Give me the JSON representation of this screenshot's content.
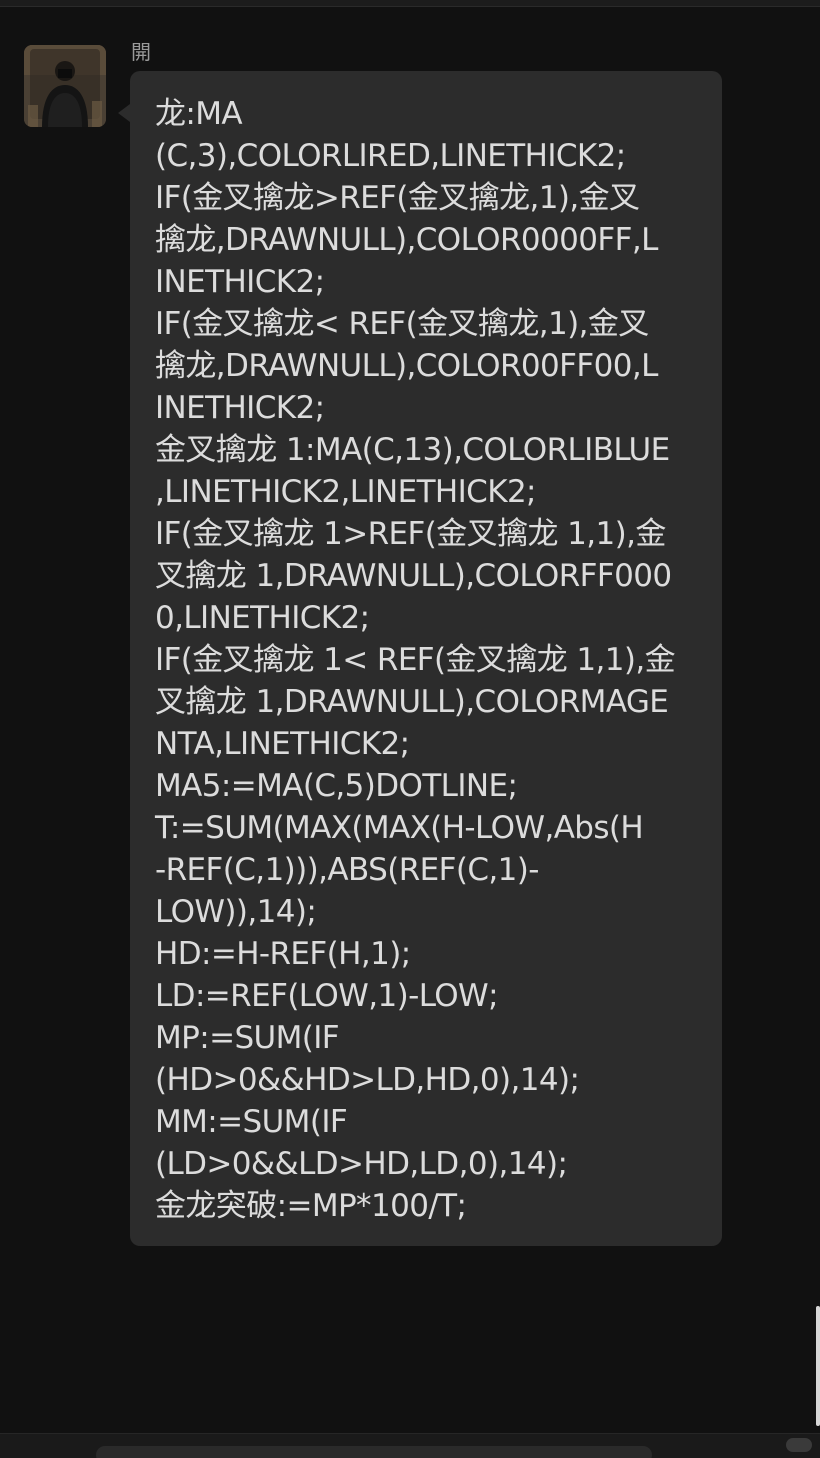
{
  "chat": {
    "sender_name": "開",
    "message_lines": [
      "龙:MA",
      "(C,3),COLORLIRED,LINETHICK2;",
      "IF(金叉擒龙>REF(金叉擒龙,1),金叉",
      "擒龙,DRAWNULL),COLOR0000FF,L",
      "INETHICK2;",
      "IF(金叉擒龙< REF(金叉擒龙,1),金叉",
      "擒龙,DRAWNULL),COLOR00FF00,L",
      "INETHICK2;",
      "金叉擒龙 1:MA(C,13),COLORLIBLUE",
      ",LINETHICK2,LINETHICK2;",
      "IF(金叉擒龙 1>REF(金叉擒龙 1,1),金",
      "叉擒龙 1,DRAWNULL),COLORFF000",
      "0,LINETHICK2;",
      "IF(金叉擒龙 1< REF(金叉擒龙 1,1),金",
      "叉擒龙 1,DRAWNULL),COLORMAGE",
      "NTA,LINETHICK2;",
      "MA5:=MA(C,5)DOTLINE;",
      "T:=SUM(MAX(MAX(H-LOW,Abs(H",
      "-REF(C,1))),ABS(REF(C,1)-",
      "LOW)),14);",
      "HD:=H-REF(H,1);",
      "LD:=REF(LOW,1)-LOW;",
      "MP:=SUM(IF",
      "(HD>0&&HD>LD,HD,0),14);",
      "MM:=SUM(IF",
      "(LD>0&&LD>HD,LD,0),14);",
      "金龙突破:=MP*100/T;"
    ],
    "message_text": "龙:MA\n(C,3),COLORLIRED,LINETHICK2;\nIF(金叉擒龙>REF(金叉擒龙,1),金叉\n擒龙,DRAWNULL),COLOR0000FF,L\nINETHICK2;\nIF(金叉擒龙< REF(金叉擒龙,1),金叉\n擒龙,DRAWNULL),COLOR00FF00,L\nINETHICK2;\n金叉擒龙 1:MA(C,13),COLORLIBLUE\n,LINETHICK2,LINETHICK2;\nIF(金叉擒龙 1>REF(金叉擒龙 1,1),金\n叉擒龙 1,DRAWNULL),COLORFF000\n0,LINETHICK2;\nIF(金叉擒龙 1< REF(金叉擒龙 1,1),金\n叉擒龙 1,DRAWNULL),COLORMAGE\nNTA,LINETHICK2;\nMA5:=MA(C,5)DOTLINE;\nT:=SUM(MAX(MAX(H-LOW,Abs(H\n-REF(C,1))),ABS(REF(C,1)-\nLOW)),14);\nHD:=H-REF(H,1);\nLD:=REF(LOW,1)-LOW;\nMP:=SUM(IF\n(HD>0&&HD>LD,HD,0),14);\nMM:=SUM(IF\n(LD>0&&LD>HD,LD,0),14);\n金龙突破:=MP*100/T;"
  },
  "colors": {
    "background": "#111111",
    "bubble": "#2c2c2c",
    "text": "#dcdcdc",
    "sender_name": "#9a9a9a"
  },
  "icons": {
    "avatar": "user-avatar-photo"
  }
}
